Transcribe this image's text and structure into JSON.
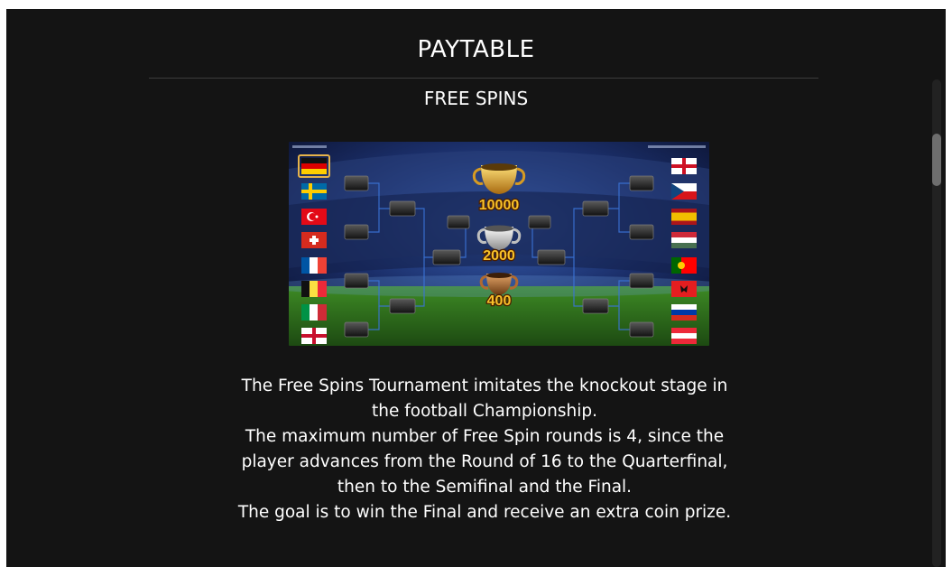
{
  "header": {
    "title": "PAYTABLE",
    "subtitle": "FREE SPINS"
  },
  "bracket": {
    "prizes": [
      "10000",
      "2000",
      "400"
    ],
    "left_flags": [
      "germany-flag-icon",
      "sweden-flag-icon",
      "turkey-flag-icon",
      "switzerland-flag-icon",
      "france-flag-icon",
      "belgium-flag-icon",
      "italy-flag-icon",
      "northern-ireland-flag-icon"
    ],
    "right_flags": [
      "england-flag-icon",
      "czech-flag-icon",
      "spain-flag-icon",
      "hungary-flag-icon",
      "portugal-flag-icon",
      "albania-flag-icon",
      "russia-flag-icon",
      "austria-flag-icon"
    ],
    "colors": {
      "gold": "#f0b020",
      "prize_text": "#f7c12a",
      "stadium_sky": "#1b2f6a",
      "pitch": "#2e6a1c"
    }
  },
  "description": [
    "The Free Spins Tournament imitates the knockout stage in",
    "the football Championship.",
    "The maximum number of Free Spin rounds is 4, since the",
    "player advances from the Round of 16 to the Quarterfinal,",
    "then to the Semifinal and the Final.",
    "The goal is to win the Final and receive an extra coin prize."
  ]
}
